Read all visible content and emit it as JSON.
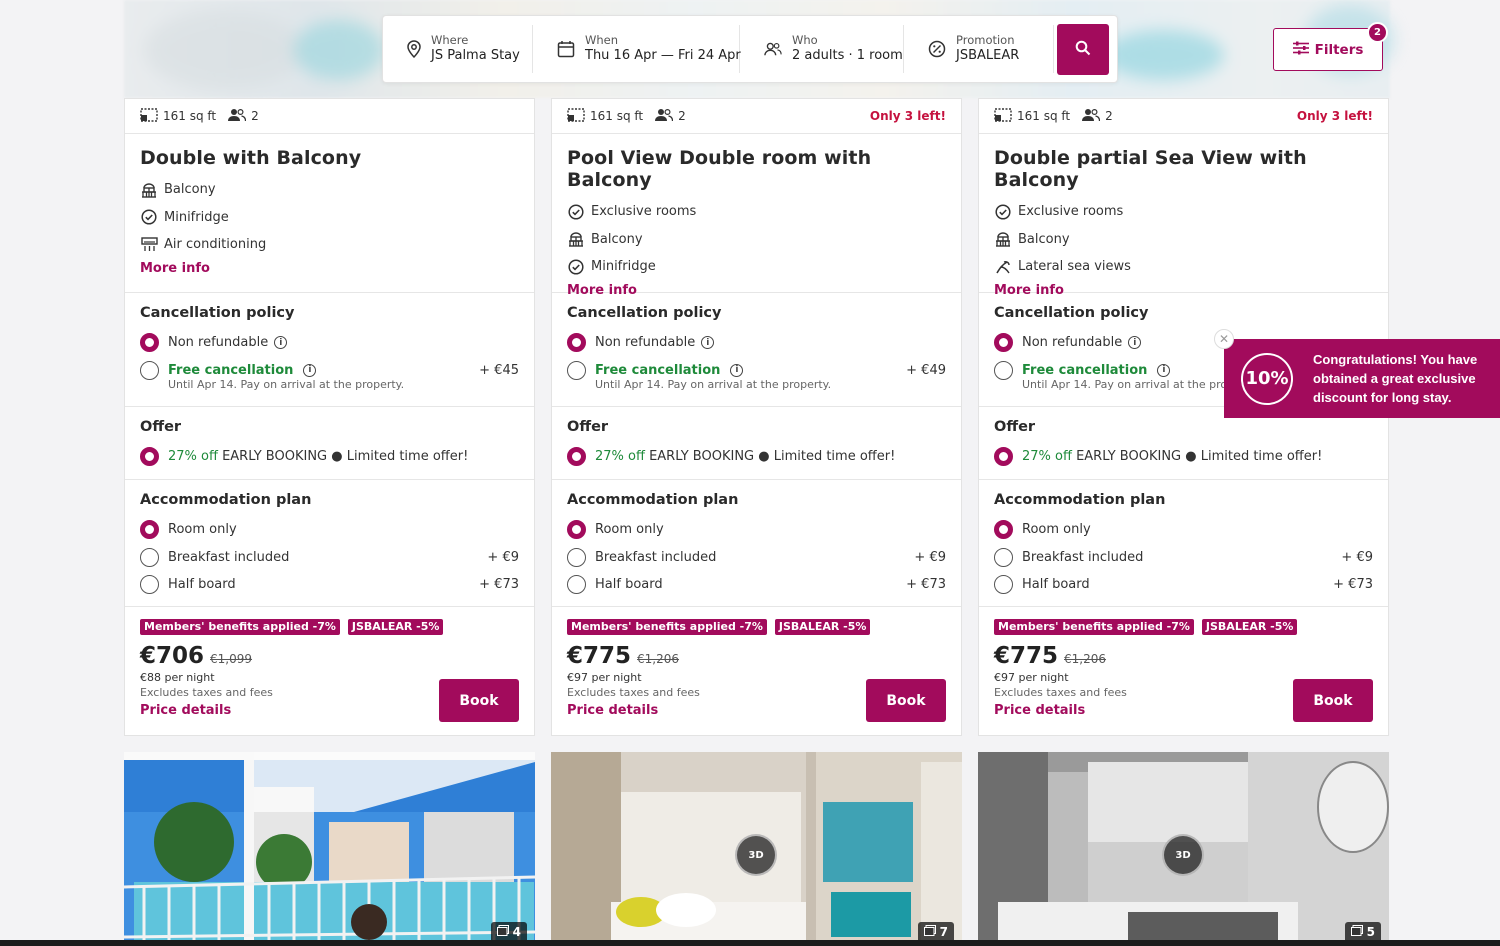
{
  "search": {
    "where_label": "Where",
    "where_value": "JS Palma Stay",
    "when_label": "When",
    "when_value": "Thu 16 Apr — Fri 24 Apr",
    "who_label": "Who",
    "who_value": "2 adults · 1 room",
    "promo_label": "Promotion",
    "promo_value": "JSBALEAR"
  },
  "filters": {
    "label": "Filters",
    "count": "2"
  },
  "colors": {
    "accent": "#a20b5c",
    "green": "#1e8a3a",
    "urgent": "#c5123f"
  },
  "cards": [
    {
      "size": "161 sq ft",
      "guests": "2",
      "availability": "",
      "title": "Double with Balcony",
      "amenities": [
        {
          "icon": "balcony-icon",
          "label": "Balcony"
        },
        {
          "icon": "check-circle-icon",
          "label": "Minifridge"
        },
        {
          "icon": "air-conditioning-icon",
          "label": "Air conditioning"
        }
      ],
      "more_info": "More info",
      "cancellation_title": "Cancellation policy",
      "non_refundable": "Non refundable",
      "free_cancellation": "Free cancellation",
      "free_cancellation_price": "+ €45",
      "free_cancellation_note": "Until Apr 14. Pay on arrival at the property.",
      "offer_title": "Offer",
      "offer_discount": "27% off",
      "offer_text": " EARLY BOOKING ● Limited time offer!",
      "plan_title": "Accommodation plan",
      "plan_room_only": "Room only",
      "plan_breakfast": "Breakfast included",
      "plan_breakfast_price": "+ €9",
      "plan_half_board": "Half board",
      "plan_half_board_price": "+ €73",
      "badge_members": "Members' benefits applied -7%",
      "badge_promo": "JSBALEAR -5%",
      "price": "€706",
      "old_price": "€1,099",
      "per_night": "€88 per night",
      "taxes": "Excludes taxes and fees",
      "price_details": "Price details",
      "book": "Book"
    },
    {
      "size": "161 sq ft",
      "guests": "2",
      "availability": "Only 3 left!",
      "title": "Pool View Double room with Balcony",
      "amenities": [
        {
          "icon": "check-circle-icon",
          "label": "Exclusive rooms"
        },
        {
          "icon": "balcony-icon",
          "label": "Balcony"
        },
        {
          "icon": "check-circle-icon",
          "label": "Minifridge"
        }
      ],
      "more_info": "More info",
      "cancellation_title": "Cancellation policy",
      "non_refundable": "Non refundable",
      "free_cancellation": "Free cancellation",
      "free_cancellation_price": "+ €49",
      "free_cancellation_note": "Until Apr 14. Pay on arrival at the property.",
      "offer_title": "Offer",
      "offer_discount": "27% off",
      "offer_text": " EARLY BOOKING ● Limited time offer!",
      "plan_title": "Accommodation plan",
      "plan_room_only": "Room only",
      "plan_breakfast": "Breakfast included",
      "plan_breakfast_price": "+ €9",
      "plan_half_board": "Half board",
      "plan_half_board_price": "+ €73",
      "badge_members": "Members' benefits applied -7%",
      "badge_promo": "JSBALEAR -5%",
      "price": "€775",
      "old_price": "€1,206",
      "per_night": "€97 per night",
      "taxes": "Excludes taxes and fees",
      "price_details": "Price details",
      "book": "Book"
    },
    {
      "size": "161 sq ft",
      "guests": "2",
      "availability": "Only 3 left!",
      "title": "Double partial Sea View with Balcony",
      "amenities": [
        {
          "icon": "check-circle-icon",
          "label": "Exclusive rooms"
        },
        {
          "icon": "balcony-icon",
          "label": "Balcony"
        },
        {
          "icon": "sea-view-icon",
          "label": "Lateral sea views"
        }
      ],
      "more_info": "More info",
      "cancellation_title": "Cancellation policy",
      "non_refundable": "Non refundable",
      "free_cancellation": "Free cancellation",
      "free_cancellation_price": "",
      "free_cancellation_note": "Until Apr 14. Pay on arrival at the prope",
      "offer_title": "Offer",
      "offer_discount": "27% off",
      "offer_text": " EARLY BOOKING ● Limited time offer!",
      "plan_title": "Accommodation plan",
      "plan_room_only": "Room only",
      "plan_breakfast": "Breakfast included",
      "plan_breakfast_price": "+ €9",
      "plan_half_board": "Half board",
      "plan_half_board_price": "+ €73",
      "badge_members": "Members' benefits applied -7%",
      "badge_promo": "JSBALEAR -5%",
      "price": "€775",
      "old_price": "€1,206",
      "per_night": "€97 per night",
      "taxes": "Excludes taxes and fees",
      "price_details": "Price details",
      "book": "Book"
    }
  ],
  "promo_popup": {
    "percent": "10%",
    "text": "Congratulations! You have obtained a great exclusive discount for long stay."
  },
  "photos": [
    {
      "count": "4",
      "has_3d": false
    },
    {
      "count": "7",
      "has_3d": true,
      "label_3d": "3D"
    },
    {
      "count": "5",
      "has_3d": true,
      "label_3d": "3D"
    }
  ]
}
